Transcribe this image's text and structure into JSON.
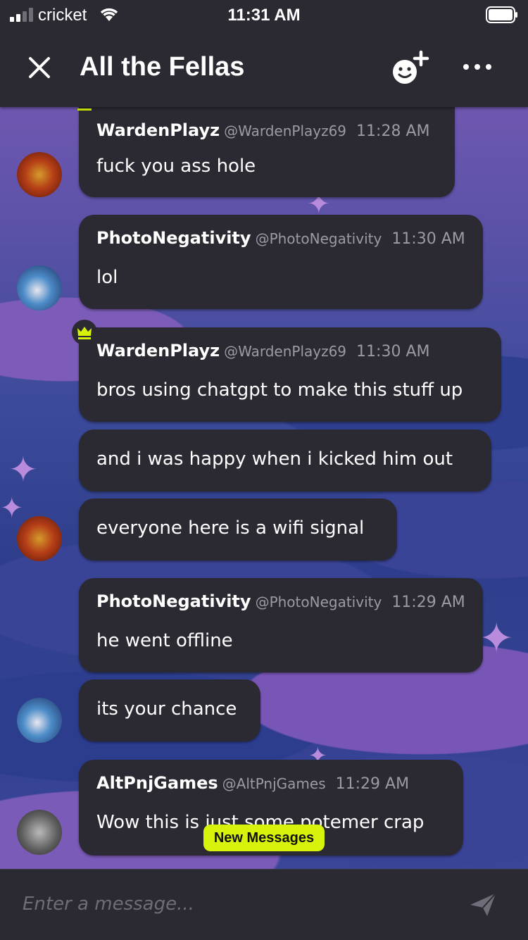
{
  "status": {
    "carrier": "cricket",
    "time": "11:31 AM"
  },
  "header": {
    "title": "All the Fellas"
  },
  "messages": [
    {
      "username": "WardenPlayz",
      "handle": "@WardenPlayz69",
      "time": "11:28 AM",
      "text": "fuck you ass hole"
    },
    {
      "username": "PhotoNegativity",
      "handle": "@PhotoNegativity",
      "time": "11:30 AM",
      "text": "lol"
    },
    {
      "username": "WardenPlayz",
      "handle": "@WardenPlayz69",
      "time": "11:30 AM",
      "text": "bros using chatgpt to make this stuff up"
    },
    {
      "text": "and i was happy when i kicked him out"
    },
    {
      "text": "everyone here is a wifi signal"
    },
    {
      "username": "PhotoNegativity",
      "handle": "@PhotoNegativity",
      "time": "11:29 AM",
      "text": "he went offline"
    },
    {
      "text": "its your chance"
    },
    {
      "username": "AltPnjGames",
      "handle": "@AltPnjGames",
      "time": "11:29 AM",
      "text": "Wow this is just some potemer crap"
    }
  ],
  "new_messages_label": "New Messages",
  "composer": {
    "placeholder": "Enter a message..."
  },
  "colors": {
    "surface": "#2b2a33",
    "highlight": "#d7f20b",
    "crown": "#d7f20b"
  }
}
